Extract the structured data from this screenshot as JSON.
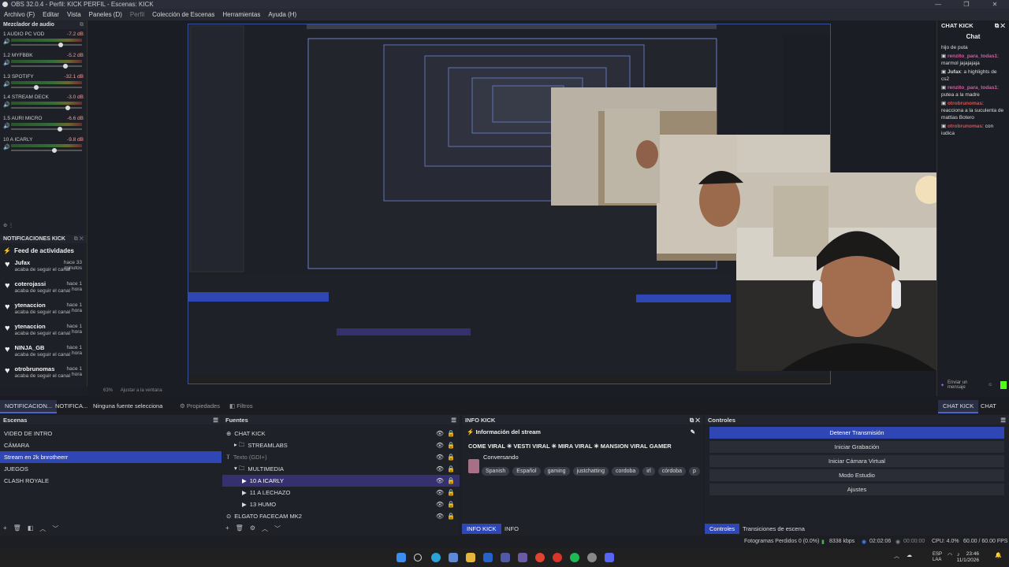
{
  "window": {
    "title": "OBS 32.0.4 - Perfil: KICK PERFIL - Escenas: KICK"
  },
  "menu": {
    "items": [
      "Archivo (F)",
      "Editar",
      "Vista",
      "Paneles (D)",
      "Perfil",
      "Colección de Escenas",
      "Herramientas",
      "Ayuda (H)"
    ]
  },
  "audio_mixer": {
    "title": "Mezclador de audio",
    "channels": [
      {
        "name": "1 AUDIO PC VOD",
        "db": "-7.2 dB",
        "level": 0.72
      },
      {
        "name": "1.2 MYFBBK",
        "db": "-5.2 dB",
        "level": 0.78
      },
      {
        "name": "1.3 SPOTIFY",
        "db": "-32.1 dB",
        "level": 0.35
      },
      {
        "name": "1.4 STREAM DECK",
        "db": "-3.0 dB",
        "level": 0.82
      },
      {
        "name": "1.5 AURI MICRO",
        "db": "-6.6 dB",
        "level": 0.7
      },
      {
        "name": "10 A ICARLY",
        "db": "-9.8 dB",
        "level": 0.62
      }
    ]
  },
  "notifications": {
    "title": "NOTIFICACIONES KICK",
    "feed_title": "Feed de actividades",
    "items": [
      {
        "user": "Jufax",
        "action": "acaba de seguir el canal",
        "time": "hace 33 minutos"
      },
      {
        "user": "coterojassi",
        "action": "acaba de seguir el canal",
        "time": "hace 1 hora"
      },
      {
        "user": "ytenaccion",
        "action": "acaba de seguir el canal",
        "time": "hace 1 hora"
      },
      {
        "user": "ytenaccion",
        "action": "acaba de seguir el canal",
        "time": "hace 1 hora"
      },
      {
        "user": "NINJA_GB",
        "action": "acaba de seguir el canal",
        "time": "hace 1 hora"
      },
      {
        "user": "otrobrunomas",
        "action": "acaba de seguir el canal",
        "time": "hace 1 hora"
      }
    ]
  },
  "preview": {
    "zoom": "63%",
    "fit_label": "Ajustar a la ventana"
  },
  "chat": {
    "dock_title": "CHAT KICK",
    "header": "Chat",
    "messages": [
      {
        "user": "",
        "text": "hijo de puta"
      },
      {
        "user": "renzito_para_todas1",
        "text": ": marmol jajajajaja"
      },
      {
        "user": "Jufax",
        "text": ": a highlights de cs2"
      },
      {
        "user": "renzito_para_todas1",
        "text": ": putea a la madre"
      },
      {
        "user": "otrobrunomas",
        "text": ": reacciona a la suculenta de mattias Botero"
      },
      {
        "user": "otrobrunomas",
        "text": ": con iudica"
      }
    ],
    "input_placeholder": "Enviar un mensaje"
  },
  "tabs": {
    "left": [
      "NOTIFICACION...",
      "NOTIFICA..."
    ],
    "source_sel": "Ninguna fuente selecciona",
    "properties": "Propiedades",
    "filters": "Filtros",
    "right": [
      "CHAT KICK",
      "CHAT"
    ]
  },
  "scenes": {
    "title": "Escenas",
    "items": [
      "VIDEO DE INTRO",
      "CÁMARA",
      "Stream en 2k bnrotheerr",
      "JUEGOS",
      "CLASH ROYALE"
    ],
    "selected_index": 2
  },
  "sources": {
    "title": "Fuentes",
    "items": [
      {
        "label": "CHAT KICK",
        "indent": 0,
        "kind": "browser"
      },
      {
        "label": "STREAMLABS",
        "indent": 1,
        "kind": "folder"
      },
      {
        "label": "Texto (GDI+)",
        "indent": 0,
        "kind": "text",
        "dim": true
      },
      {
        "label": "MULTIMEDIA",
        "indent": 1,
        "kind": "folder-open"
      },
      {
        "label": "10 A ICARLY",
        "indent": 2,
        "kind": "media",
        "sel": true
      },
      {
        "label": "11 A LECHAZO",
        "indent": 2,
        "kind": "media"
      },
      {
        "label": "13 HUMO",
        "indent": 2,
        "kind": "media"
      },
      {
        "label": "ELGATO FACECAM MK2",
        "indent": 0,
        "kind": "camera"
      }
    ]
  },
  "info_kick": {
    "title": "INFO KICK",
    "section": "Información del stream",
    "stream_title": "COME VIRAL ✳ VESTI VIRAL ✳ MIRA VIRAL ✳ MANSION VIRAL GAMER",
    "category": "Conversando",
    "tags": [
      "Spanish",
      "Español",
      "gaming",
      "justchatting",
      "cordoba",
      "irl",
      "córdoba",
      "p"
    ],
    "bottom_tabs": [
      "INFO KICK",
      "INFO"
    ]
  },
  "controls": {
    "title": "Controles",
    "buttons": [
      "Detener Transmisión",
      "Iniciar Grabación",
      "Iniciar Cámara Virtual",
      "Modo Estudio",
      "Ajustes"
    ],
    "bottom_tabs": [
      "Controles",
      "Transiciones de escena"
    ]
  },
  "status": {
    "frames_dropped": "Fotogramas Perdidos 0 (0.0%)",
    "bitrate": "8338 kbps",
    "live_time": "02:02:06",
    "rec_time": "00:00:00",
    "cpu": "CPU: 4.0%",
    "fps": "60.00 / 60.00 FPS"
  },
  "taskbar": {
    "lang": "ESP\nLAA",
    "time": "23:46",
    "date": "11/1/2026"
  },
  "colors": {
    "accent": "#2f47b4",
    "bg": "#1d1f26",
    "live_green": "#4caf50"
  }
}
